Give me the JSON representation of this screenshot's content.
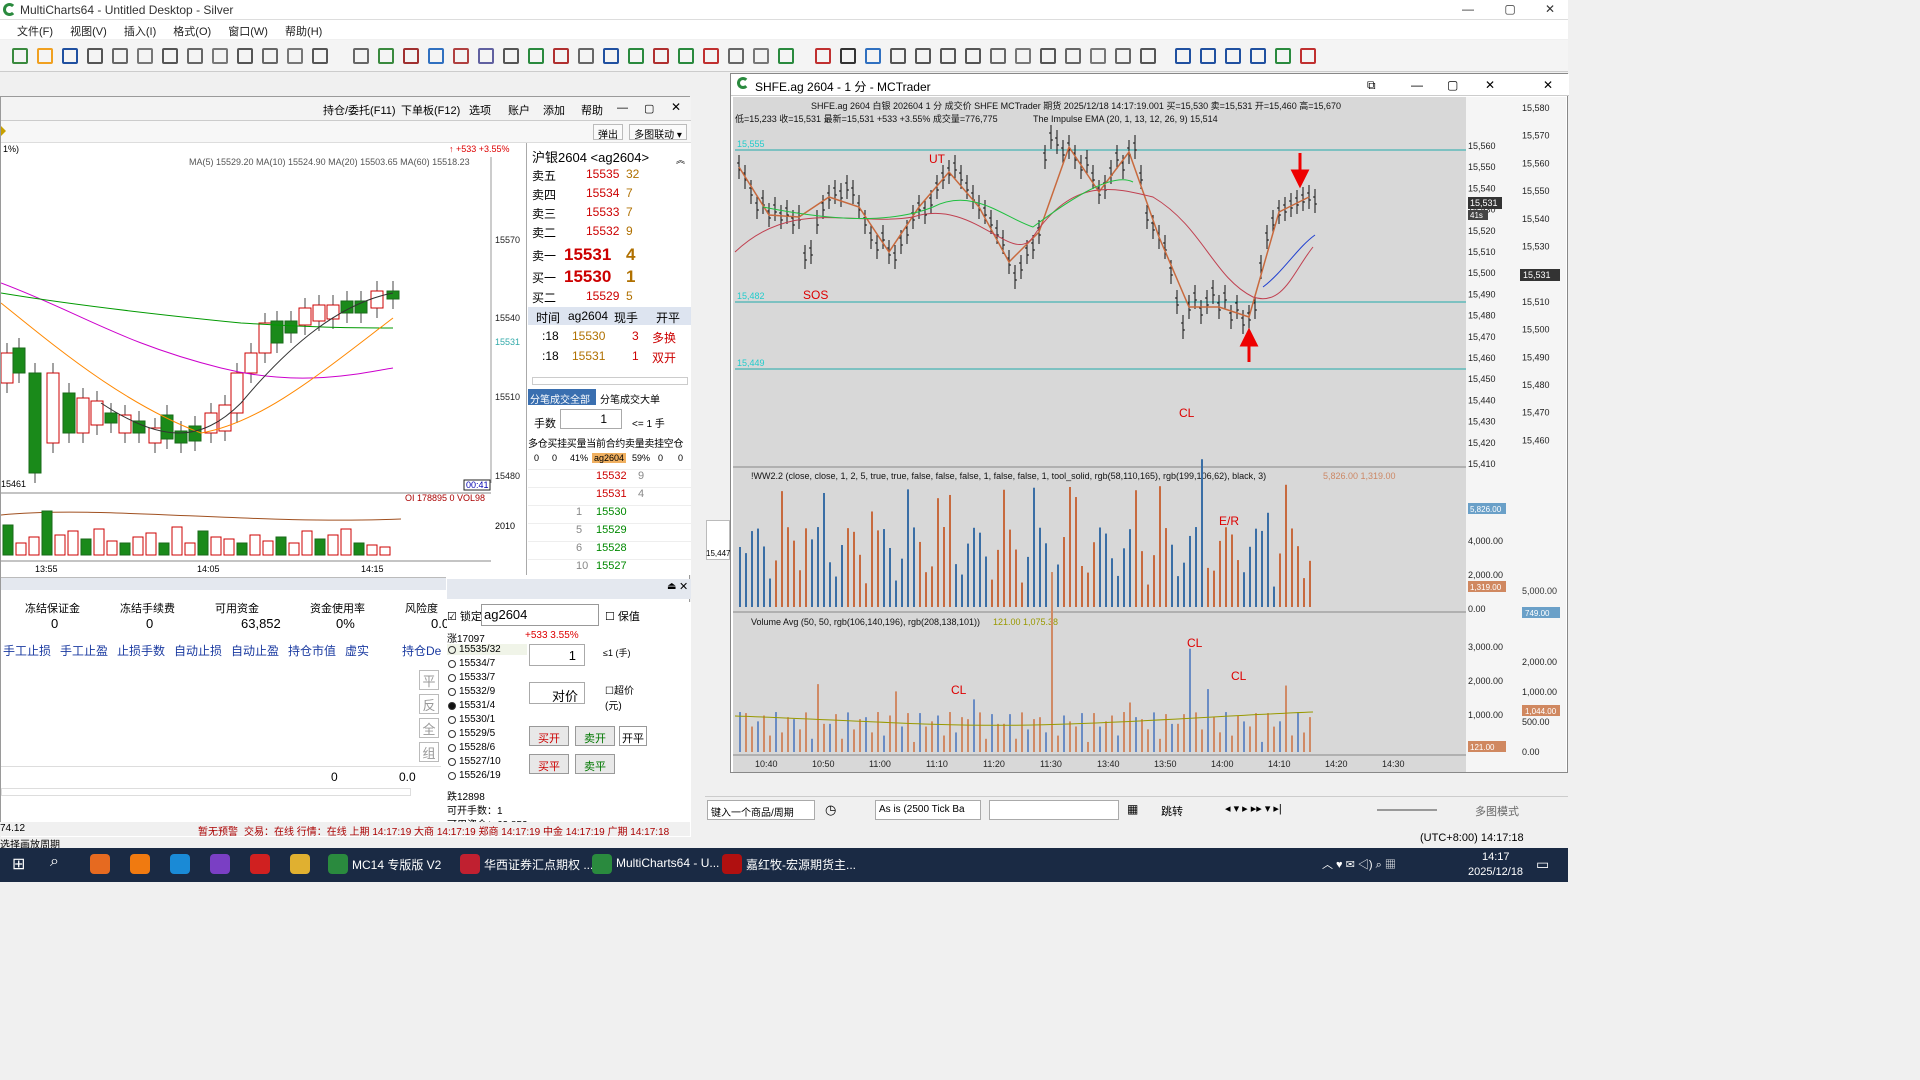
{
  "window": {
    "title": "MultiCharts64 - Untitled Desktop - Silver"
  },
  "menu": [
    "文件(F)",
    "视图(V)",
    "插入(I)",
    "格式(O)",
    "窗口(W)",
    "帮助(H)"
  ],
  "left_panel": {
    "tabs": [
      "持仓/委托(F11)",
      "下单板(F12)",
      "选项",
      "账户",
      "添加",
      "帮助"
    ],
    "popout": "弹出",
    "multi_link": "多图联动 ▾",
    "chart": {
      "change": "↑ +533 +3.55%",
      "ma_text": "MA(5) 15529.20  MA(10) 15524.90  MA(20) 15503.65  MA(60) 15518.23",
      "price_labels": [
        "15570",
        "15540",
        "15531",
        "15510",
        "15480"
      ],
      "low_label": "15461",
      "time_labels": [
        "13:55",
        "14:05",
        "14:15"
      ],
      "countdown": "00:41",
      "oi": "OI 178895  0  VOL98",
      "vol_label": "2010",
      "pct_label": "1%)"
    },
    "orderbook": {
      "title": "沪银2604 <ag2604>",
      "asks": [
        {
          "lbl": "卖五",
          "p": "15535",
          "v": "32"
        },
        {
          "lbl": "卖四",
          "p": "15534",
          "v": "7"
        },
        {
          "lbl": "卖三",
          "p": "15533",
          "v": "7"
        },
        {
          "lbl": "卖二",
          "p": "15532",
          "v": "9"
        }
      ],
      "ask1": {
        "lbl": "卖一",
        "p": "15531",
        "v": "4"
      },
      "bid1": {
        "lbl": "买一",
        "p": "15530",
        "v": "1"
      },
      "bid2": {
        "lbl": "买二",
        "p": "15529",
        "v": "5"
      },
      "trade_header": [
        "时间",
        "ag2604",
        "现手",
        "开平"
      ],
      "trades": [
        {
          "t": ":18",
          "p": "15530",
          "v": "3",
          "k": "多换"
        },
        {
          "t": ":18",
          "p": "15531",
          "v": "1",
          "k": "双开"
        }
      ],
      "tab_all": "分笔成交全部",
      "tab_big": "分笔成交大单",
      "qty_label": "手数",
      "qty": "1",
      "qty_max": "<= 1 手",
      "grid_header": "多仓买挂买量当前合约卖量卖挂空仓",
      "grid_row": [
        "0",
        "0",
        "41%",
        "ag2604",
        "59%",
        "0",
        "0"
      ],
      "ladder": [
        "15532",
        "15531",
        "15530",
        "15529",
        "15528",
        "15527"
      ],
      "ladder_vol": [
        "9",
        "4",
        "1",
        "5",
        "6",
        "10"
      ]
    },
    "account": {
      "headers": [
        "冻结保证金",
        "冻结手续费",
        "可用资金",
        "资金使用率",
        "风险度"
      ],
      "values": [
        "0",
        "0",
        "63,852",
        "0%",
        "0.0%"
      ],
      "buttons": [
        "手工止损",
        "手工止盈",
        "止损手数",
        "自动止损",
        "自动止盈",
        "持仓市值",
        "虚实",
        "持仓De"
      ],
      "side": [
        "平",
        "反",
        "全",
        "组"
      ],
      "totals": [
        "0",
        "0.0"
      ]
    },
    "order2": {
      "lock": "锁定",
      "symbol": "ag2604",
      "keep": "保值",
      "limit_up": "涨17097",
      "change": "+533  3.55%",
      "asks": [
        "15535/32",
        "15534/7",
        "15533/7",
        "15532/9",
        "15531/4"
      ],
      "bids": [
        "15530/1",
        "15529/5",
        "15528/6",
        "15527/10",
        "15526/19"
      ],
      "limit_down": "跌12898",
      "open_qty": "可开手数：1",
      "avail": "可用资金：63,852",
      "qty": "1",
      "qty_note": "≤1 (手)",
      "price": "对价",
      "over": "超价 (元)",
      "buy_open": "买开",
      "sell_open": "卖开",
      "open_close": "开平",
      "buy_close": "买平",
      "sell_close": "卖平"
    },
    "status": {
      "left": "74.12",
      "msg": "暂无预警",
      "items": "交易：在线  行情：在线  上期 14:17:19  大商 14:17:19  郑商 14:17:19  中金 14:17:19  广期 14:17:18",
      "bottom": "选择画放周期"
    }
  },
  "main_chart": {
    "title": "SHFE.ag 2604 - 1 分 - MCTrader",
    "header": "SHFE.ag 2604   白银 202604  1 分   成交价  SHFE  MCTrader  期货  2025/12/18  14:17:19.001  买=15,530  卖=15,531  开=15,460  高=15,670",
    "header2": "低=15,233  收=15,531  最新=15,531  +533  +3.55%   成交量=776,775",
    "indicator1": "The Impulse EMA  (20, 1, 13, 12, 26, 9)  15,514",
    "indicator2": "!WW2.2   (close, close, 1, 2, 5, true, true, false, false, false, 1, false, false, 1, tool_solid, rgb(58,110,165), rgb(199,106,62), black, 3)",
    "indicator2_vals": "5,826.00  1,319.00",
    "indicator3": "Volume Avg   (50, 50, rgb(106,140,196), rgb(208,138,101))",
    "indicator3_vals": "121.00   1,075.38",
    "level_labels": [
      "15,555",
      "15,482",
      "15,449"
    ],
    "annotations": {
      "ut": "UT",
      "sos": "SOS",
      "cl": "CL",
      "er": "E/R"
    },
    "price_axis": [
      "15,560",
      "15,550",
      "15,540",
      "15,530",
      "15,520",
      "15,510",
      "15,500",
      "15,490",
      "15,480",
      "15,470",
      "15,460",
      "15,450",
      "15,440",
      "15,430",
      "15,420",
      "15,410"
    ],
    "price_axis2": [
      "15,580",
      "15,570",
      "15,560",
      "15,550",
      "15,540",
      "15,530",
      "15,520",
      "15,510",
      "15,500",
      "15,490",
      "15,480",
      "15,470",
      "15,460"
    ],
    "last_price": "15,531",
    "last_price2": "15,531",
    "countdown": "41s",
    "wave_axis": [
      "4,000.00",
      "2,000.00",
      "0.00"
    ],
    "wave_axis2": [
      "5,000.00"
    ],
    "wave_tags": [
      "5,826.00",
      "1,319.00"
    ],
    "wave_tag2": "749.00",
    "vol_axis": [
      "3,000.00",
      "2,000.00",
      "1,000.00",
      "0.00"
    ],
    "vol_axis2": [
      "2,000.00",
      "1,000.00",
      "500.00",
      "0.00"
    ],
    "vol_tags": [
      "1,044.00",
      "121.00"
    ],
    "time_axis": [
      "10:40",
      "10:50",
      "11:00",
      "11:10",
      "11:20",
      "11:30",
      "13:40",
      "13:50",
      "14:00",
      "14:10",
      "14:20",
      "14:30"
    ],
    "side_price": "15,447"
  },
  "bottom_bar": {
    "symbol_input": "键入一个商品/周期",
    "resolution": "As is (2500 Tick Ba",
    "jump": "跳转",
    "multi": "多图模式",
    "tz": "(UTC+8:00) 14:17:18"
  },
  "taskbar": {
    "apps": [
      "MC14 专版版 V2",
      "华西证券汇点期权 ...",
      "MultiCharts64 - U...",
      "嘉红牧-宏源期货主..."
    ],
    "time": "14:17",
    "date": "2025/12/18"
  }
}
